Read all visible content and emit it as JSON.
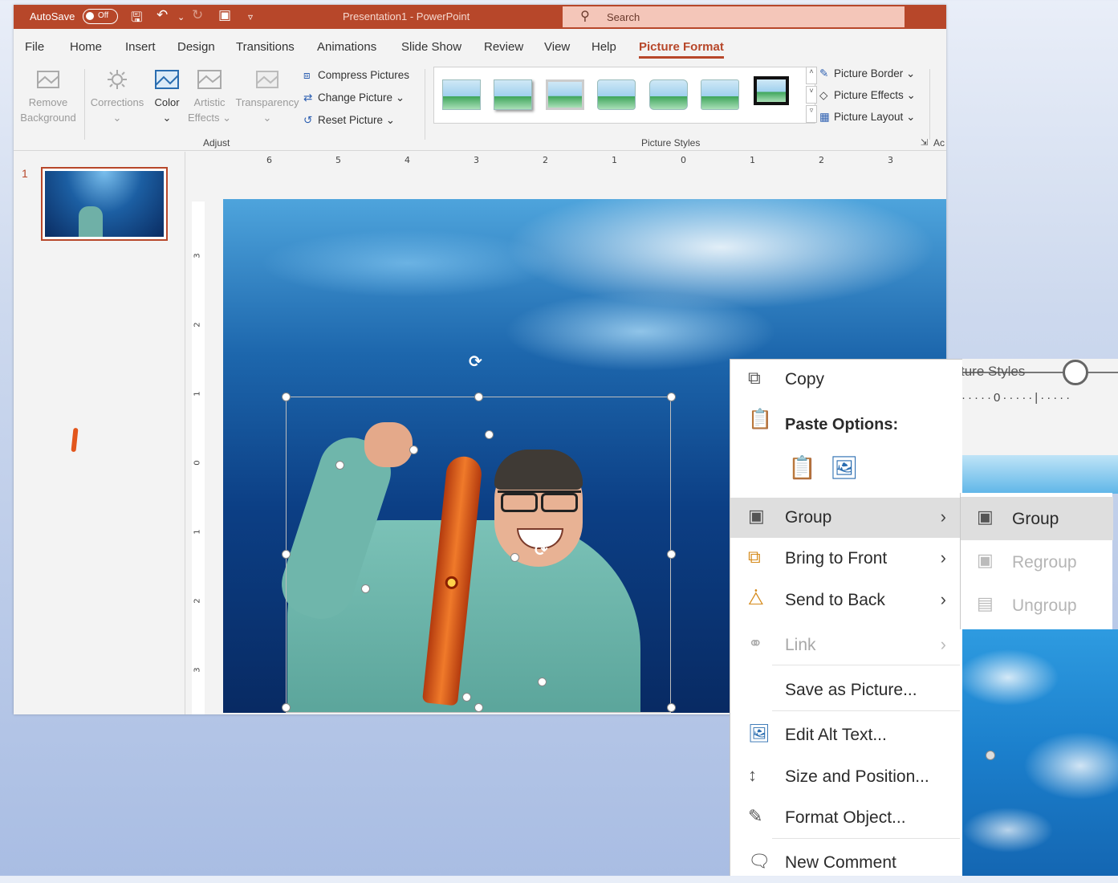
{
  "titlebar": {
    "autosave_label": "AutoSave",
    "autosave_state": "Off",
    "document_title": "Presentation1  -  PowerPoint",
    "search_placeholder": "Search"
  },
  "tabs": [
    "File",
    "Home",
    "Insert",
    "Design",
    "Transitions",
    "Animations",
    "Slide Show",
    "Review",
    "View",
    "Help",
    "Picture Format"
  ],
  "active_tab": "Picture Format",
  "ribbon": {
    "adjust": {
      "remove_background": "Remove Background",
      "remove_bg_line1": "Remove",
      "remove_bg_line2": "Background",
      "corrections": "Corrections",
      "color": "Color",
      "artistic_line1": "Artistic",
      "artistic_line2": "Effects",
      "transparency": "Transparency",
      "compress": "Compress Pictures",
      "change": "Change Picture",
      "reset": "Reset Picture",
      "group_label": "Adjust"
    },
    "styles": {
      "group_label": "Picture Styles",
      "border": "Picture Border",
      "effects": "Picture Effects",
      "layout": "Picture Layout",
      "truncated_next": "Ac"
    }
  },
  "ruler_h": [
    "6",
    "5",
    "4",
    "3",
    "2",
    "1",
    "0",
    "1",
    "2",
    "3"
  ],
  "ruler_v": [
    "3",
    "2",
    "1",
    "0",
    "1",
    "2",
    "3"
  ],
  "slides_pane": {
    "slide_number": "1"
  },
  "context_menu": {
    "copy": "Copy",
    "paste_options": "Paste Options:",
    "group": "Group",
    "bring_to_front": "Bring to Front",
    "send_to_back": "Send to Back",
    "link": "Link",
    "save_as_picture": "Save as Picture...",
    "edit_alt_text": "Edit Alt Text...",
    "size_and_position": "Size and Position...",
    "format_object": "Format Object...",
    "new_comment": "New Comment"
  },
  "submenu": {
    "group": "Group",
    "regroup": "Regroup",
    "ungroup": "Ungroup"
  },
  "zoom_inset": {
    "label": "ture Styles",
    "ruler_zero": "0"
  },
  "colors": {
    "accent": "#b7472a",
    "ribbon_bg": "#f3f3f3",
    "menu_highlight": "#dedede"
  }
}
